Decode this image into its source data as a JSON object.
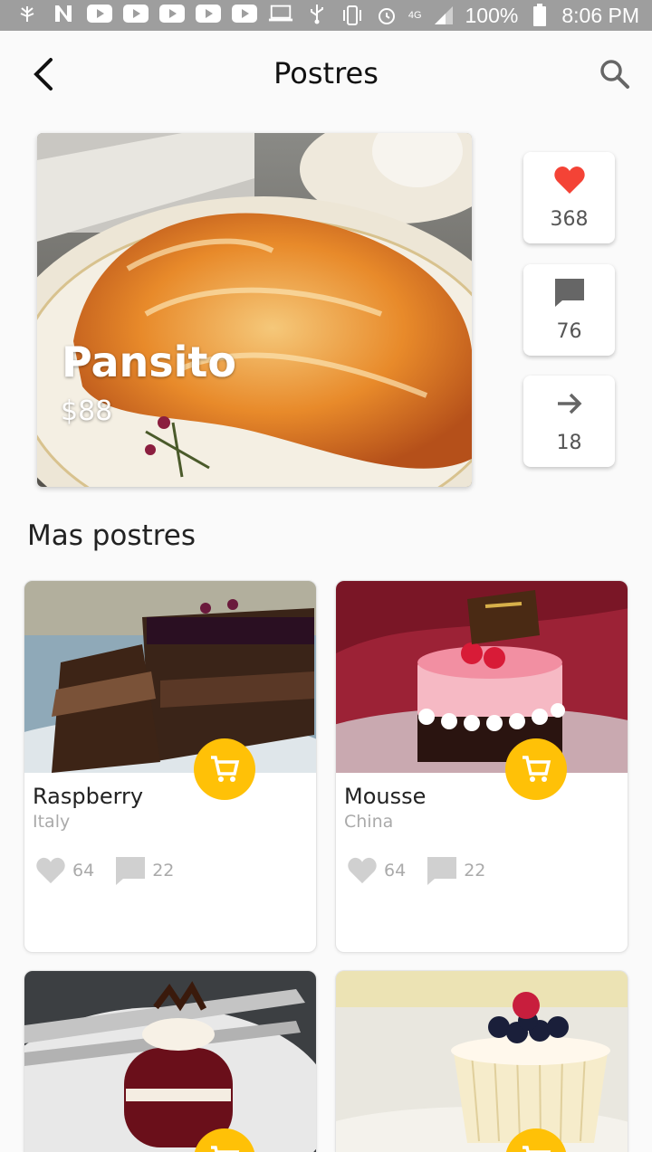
{
  "status_bar": {
    "battery": "100%",
    "time": "8:06 PM",
    "network": "4G",
    "icons": [
      "leaf-icon",
      "n-icon",
      "youtube-icon",
      "youtube-icon",
      "youtube-icon",
      "youtube-icon",
      "youtube-icon",
      "laptop-icon",
      "usb-icon",
      "vibrate-icon",
      "alarm-icon",
      "signal-icon",
      "battery-icon"
    ]
  },
  "header": {
    "title": "Postres"
  },
  "featured": {
    "name": "Pansito",
    "price": "$88",
    "likes": "368",
    "comments": "76",
    "shares": "18"
  },
  "section": {
    "title": "Mas postres"
  },
  "products": [
    {
      "name": "Raspberry",
      "origin": "Italy",
      "likes": "64",
      "comments": "22"
    },
    {
      "name": "Mousse",
      "origin": "China",
      "likes": "64",
      "comments": "22"
    },
    {
      "name": "",
      "origin": "",
      "likes": "",
      "comments": ""
    },
    {
      "name": "",
      "origin": "",
      "likes": "",
      "comments": ""
    }
  ],
  "colors": {
    "accent": "#ffc107",
    "like": "#f44336",
    "status_bar": "#9e9e9e"
  }
}
